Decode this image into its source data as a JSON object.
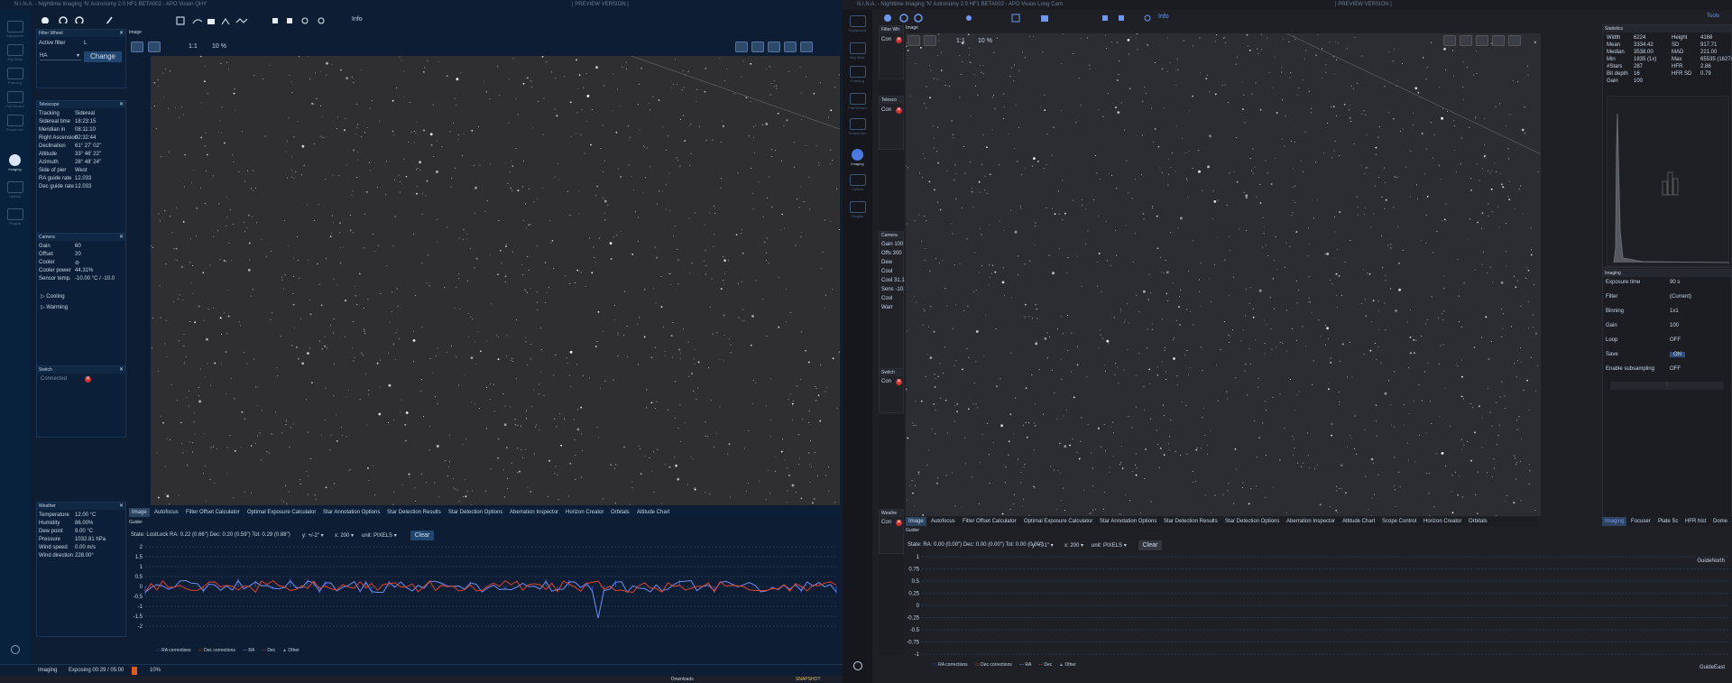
{
  "left": {
    "title": "N.I.N.A. - Nighttime Imaging 'N' Astronomy 2.0 HF1 BETA002 - APO Vision QHY",
    "preview": "| PREVIEW VERSION |",
    "info": "Info",
    "filter_panel": {
      "title": "Filter Wheel",
      "active_label": "Active filter",
      "active_value": "L",
      "select_value": "HA",
      "change_label": "Change"
    },
    "telescope": {
      "title": "Telescope",
      "rows": [
        {
          "k": "Tracking",
          "v": "Sidereal"
        },
        {
          "k": "Sidereal time",
          "v": "18:23:15"
        },
        {
          "k": "Meridian in",
          "v": "08:11:10"
        },
        {
          "k": "Right Ascension",
          "v": "02:32:44"
        },
        {
          "k": "Declination",
          "v": "61° 27' 02\""
        },
        {
          "k": "Altitude",
          "v": "33° 46' 22\""
        },
        {
          "k": "Azimuth",
          "v": "28° 48' 24\""
        },
        {
          "k": "Side of pier",
          "v": "West"
        },
        {
          "k": "RA guide rate",
          "v": "12.033"
        },
        {
          "k": "Dec guide rate",
          "v": "12.033"
        }
      ]
    },
    "camera": {
      "title": "Camera",
      "rows": [
        {
          "k": "Gain",
          "v": "60"
        },
        {
          "k": "Offset",
          "v": "20"
        },
        {
          "k": "Cooler",
          "v": "⊘"
        },
        {
          "k": "Cooler power",
          "v": "44.31%"
        },
        {
          "k": "Sensor temp.",
          "v": "-10.00 °C / -10.0"
        }
      ],
      "cooling": "Cooling",
      "warming": "Warming"
    },
    "switch": {
      "title": "Switch",
      "connected": "Connected"
    },
    "weather": {
      "title": "Weather",
      "rows": [
        {
          "k": "Temperature",
          "v": "12.00 °C"
        },
        {
          "k": "Humidity",
          "v": "86.00%"
        },
        {
          "k": "Dew point",
          "v": "9.00 °C"
        },
        {
          "k": "Pressure",
          "v": "1032.81 hPa"
        },
        {
          "k": "Wind speed",
          "v": "0.00 m/s"
        },
        {
          "k": "Wind direction",
          "v": "228.00°"
        }
      ]
    },
    "image_title": "Image",
    "zoom_ratio": "1:1",
    "zoom_pct": "10 %",
    "tabs": [
      "Image",
      "Autofocus",
      "Filter Offset Calculator",
      "Optimal Exposure Calculator",
      "Star Annotation Options",
      "Star Detection Results",
      "Star Detection Options",
      "Aberration Inspector",
      "Horizon Creator",
      "Orbitals",
      "Altitude Chart"
    ],
    "guider": {
      "title": "Guider",
      "state": "State: LostLock  RA: 0.22 (0.66\")  Dec: 0.20 (0.59\")  Tot: 0.29 (0.88\")",
      "y": "y: +/-2\"",
      "x": "x: 200",
      "unit": "unit: PIXELS",
      "clear": "Clear",
      "yticks": [
        "2",
        "1.5",
        "1",
        "0.5",
        "0",
        "-0.5",
        "-1",
        "-1.5",
        "-2"
      ],
      "legend": [
        "RA corrections",
        "Dec corrections",
        "RA",
        "Dec",
        "Other"
      ]
    },
    "status": {
      "imaging": "Imaging",
      "exposing": "Exposing 00:29 / 05:00",
      "progress": "10%"
    },
    "taskbar": [
      "Downloads",
      "SNAPSHOT"
    ],
    "rail": [
      "Equipment",
      "Sky Atlas",
      "Framing",
      "Flat Wizard",
      "Sequencer",
      "Imaging",
      "Options",
      "Plugins"
    ]
  },
  "right": {
    "title": "N.I.N.A. - Nighttime Imaging 'N' Astronomy 2.0 HF1 BETA002 - APO Vision Long Cam",
    "preview": "| PREVIEW VERSION |",
    "info": "Info",
    "tools": "Tools",
    "filter_panel": {
      "title": "Filter Wh",
      "con": "Con"
    },
    "telescope": {
      "title": "Telesco",
      "con": "Con"
    },
    "camera": {
      "title": "Camera",
      "rows": [
        "Gain  100",
        "Offs  300",
        "Dew",
        "Cool",
        "Cool  31.1",
        "Sens  -10.",
        "Cool",
        "Warr"
      ]
    },
    "switch": {
      "title": "Switch",
      "con": "Con"
    },
    "weather": {
      "title": "Weathe",
      "con": "Con"
    },
    "image_title": "Image",
    "zoom_ratio": "1:1",
    "zoom_pct": "10 %",
    "tabs": [
      "Image",
      "Autofocus",
      "Filter Offset Calculator",
      "Optimal Exposure Calculator",
      "Star Annotation Options",
      "Star Detection Results",
      "Star Detection Options",
      "Aberration Inspector",
      "Altitude Chart",
      "Scope Control",
      "Horizon Creator",
      "Orbitals"
    ],
    "side_tabs": [
      "Imaging",
      "Focuser",
      "Plate Sc",
      "HFR hist",
      "Dome"
    ],
    "statistics": {
      "title": "Statistics",
      "rows": [
        {
          "k": "Width",
          "v": "6224",
          "k2": "Height",
          "v2": "4168"
        },
        {
          "k": "Mean",
          "v": "3334.42",
          "k2": "SD",
          "v2": "917.71"
        },
        {
          "k": "Median",
          "v": "3538.00",
          "k2": "MAD",
          "v2": "221.00"
        },
        {
          "k": "Min",
          "v": "1835 (1x)",
          "k2": "Max",
          "v2": "65535 (1627x"
        },
        {
          "k": "#Stars",
          "v": "287",
          "k2": "HFR",
          "v2": "2.86"
        },
        {
          "k": "Bit depth",
          "v": "16",
          "k2": "HFR SD",
          "v2": "0.79"
        },
        {
          "k": "Gain",
          "v": "100",
          "k2": "",
          "v2": ""
        }
      ]
    },
    "imaging": {
      "title": "Imaging",
      "rows": [
        {
          "k": "Exposure time",
          "v": "90",
          "unit": "s"
        },
        {
          "k": "Filter",
          "v": "(Current)"
        },
        {
          "k": "Binning",
          "v": "1x1"
        },
        {
          "k": "Gain",
          "v": "100"
        },
        {
          "k": "Loop",
          "v": "OFF"
        },
        {
          "k": "Save",
          "v": "ON"
        },
        {
          "k": "Enable subsampling",
          "v": "OFF"
        }
      ]
    },
    "guider": {
      "title": "Guider",
      "state": "State:  RA: 0.00 (0.00\")  Dec: 0.00 (0.00\")  Tot: 0.00 (0.00\")",
      "y": "y: +/-1\"",
      "x": "x: 200",
      "unit": "unit: PIXELS",
      "clear": "Clear",
      "yticks": [
        "1",
        "0.75",
        "0.5",
        "0.25",
        "0",
        "-0.25",
        "-0.5",
        "-0.75",
        "-1"
      ],
      "north": "GuideNorth",
      "east": "GuideEast",
      "legend": [
        "RA corrections",
        "Dec corrections",
        "RA",
        "Dec",
        "Other"
      ]
    },
    "rail": [
      "Equipment",
      "Sky Atlas",
      "Framing",
      "Flat Wizard",
      "Sequencer",
      "Imaging",
      "Options",
      "Plugins"
    ]
  }
}
